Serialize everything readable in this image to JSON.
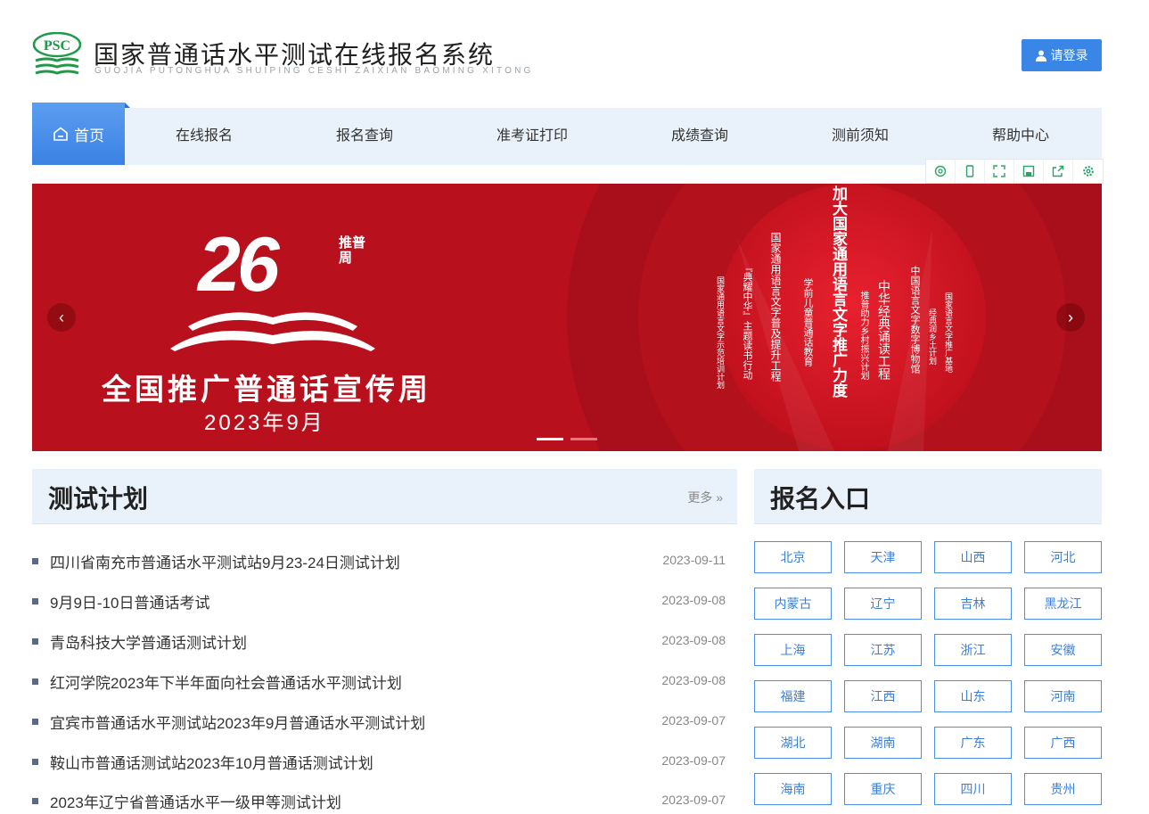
{
  "header": {
    "logo_text": "PSC",
    "title": "国家普通话水平测试在线报名系统",
    "subtitle": "GUOJIA PUTONGHUA SHUIPING CESHI ZAIXIAN BAOMING XITONG",
    "login_label": "请登录"
  },
  "nav": {
    "home": "首页",
    "items": [
      "在线报名",
      "报名查询",
      "准考证打印",
      "成绩查询",
      "测前须知",
      "帮助中心"
    ]
  },
  "toolbar": {
    "icons": [
      "refresh-icon",
      "mobile-icon",
      "fullscreen-icon",
      "save-icon",
      "share-icon",
      "settings-icon"
    ]
  },
  "banner": {
    "number": "26",
    "tag": "推普周",
    "title": "全国推广普通话宣传周",
    "date": "2023年9月",
    "main_slogan": "加大国家通用语言文字推广力度",
    "lines": [
      "国家通用语言文字示范培训计划",
      "『典耀中华』主题读书行动",
      "国家通用语言文字普及提升工程",
      "学前儿童普通话教育",
      "推普助力乡村振兴计划",
      "中华经典诵读工程",
      "中国语言文字数字博物馆",
      "经典润乡土计划",
      "国家语言文字推广基地"
    ],
    "prev": "‹",
    "next": "›",
    "colors": {
      "bg": "#b8111d",
      "circle": "#d4162a"
    }
  },
  "plan": {
    "title": "测试计划",
    "more": "更多 »",
    "items": [
      {
        "title": "四川省南充市普通话水平测试站9月23-24日测试计划",
        "date": "2023-09-11"
      },
      {
        "title": "9月9日-10日普通话考试",
        "date": "2023-09-08"
      },
      {
        "title": "青岛科技大学普通话测试计划",
        "date": "2023-09-08"
      },
      {
        "title": "红河学院2023年下半年面向社会普通话水平测试计划",
        "date": "2023-09-08"
      },
      {
        "title": "宜宾市普通话水平测试站2023年9月普通话水平测试计划",
        "date": "2023-09-07"
      },
      {
        "title": "鞍山市普通话测试站2023年10月普通话测试计划",
        "date": "2023-09-07"
      },
      {
        "title": "2023年辽宁省普通话水平一级甲等测试计划",
        "date": "2023-09-07"
      }
    ]
  },
  "entry": {
    "title": "报名入口",
    "provinces": [
      "北京",
      "天津",
      "山西",
      "河北",
      "内蒙古",
      "辽宁",
      "吉林",
      "黑龙江",
      "上海",
      "江苏",
      "浙江",
      "安徽",
      "福建",
      "江西",
      "山东",
      "河南",
      "湖北",
      "湖南",
      "广东",
      "广西",
      "海南",
      "重庆",
      "四川",
      "贵州"
    ]
  },
  "colors": {
    "accent": "#3a86e6",
    "nav_bg": "#e9f2fb",
    "logo_green": "#1e9a48"
  }
}
